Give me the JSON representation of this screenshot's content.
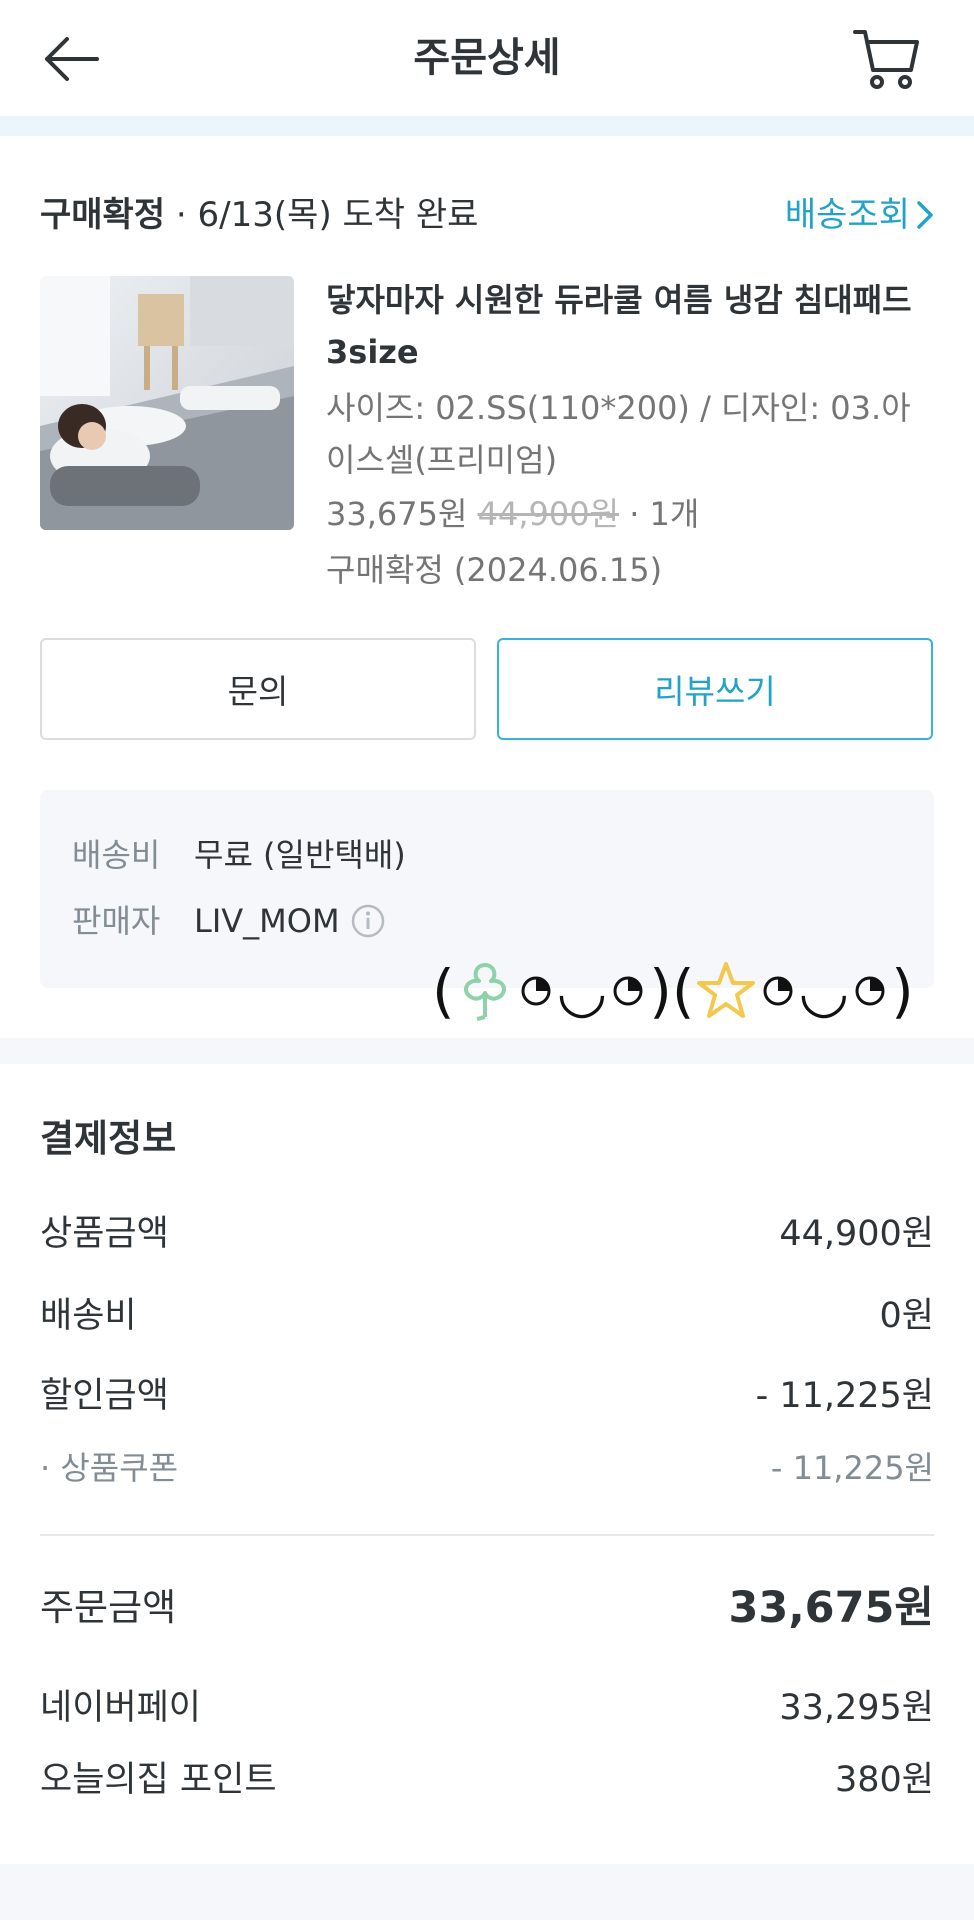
{
  "header": {
    "title": "주문상세",
    "back_icon": "arrow-left-icon",
    "cart_icon": "cart-icon"
  },
  "order": {
    "status_label": "구매확정",
    "status_detail": " · 6/13(목) 도착 완료",
    "tracking_label": "배송조회",
    "product": {
      "name": "닿자마자 시원한 듀라쿨 여름 냉감 침대패드 3size",
      "option": "사이즈: 02.SS(110*200) / 디자인: 03.아이스셀(프리미엄)",
      "price": "33,675원",
      "original_price": "44,900원",
      "quantity": " · 1개",
      "confirm_status": "구매확정 (2024.06.15)"
    },
    "buttons": {
      "inquiry": "문의",
      "review": "리뷰쓰기"
    },
    "delivery_info": {
      "shipping_key": "배송비",
      "shipping_value": "무료 (일반택배)",
      "seller_key": "판매자",
      "seller_value": "LIV_MOM"
    }
  },
  "emoticon": {
    "open": "(",
    "close": ")",
    "mouth": "◡",
    "icons": [
      "clover-icon",
      "star-icon"
    ]
  },
  "payment": {
    "title": "결제정보",
    "rows": [
      {
        "label": "상품금액",
        "value": "44,900원"
      },
      {
        "label": "배송비",
        "value": "0원"
      },
      {
        "label": "할인금액",
        "value": "- 11,225원"
      }
    ],
    "coupon": {
      "label": "· 상품쿠폰",
      "value": "- 11,225원"
    },
    "total": {
      "label": "주문금액",
      "value": "33,675원"
    },
    "methods": [
      {
        "label": "네이버페이",
        "value": "33,295원"
      },
      {
        "label": "오늘의집 포인트",
        "value": "380원"
      }
    ]
  },
  "colors": {
    "accent": "#21a3c9",
    "text": "#2f3438",
    "muted": "#757575",
    "panel": "#f5f7fa"
  }
}
